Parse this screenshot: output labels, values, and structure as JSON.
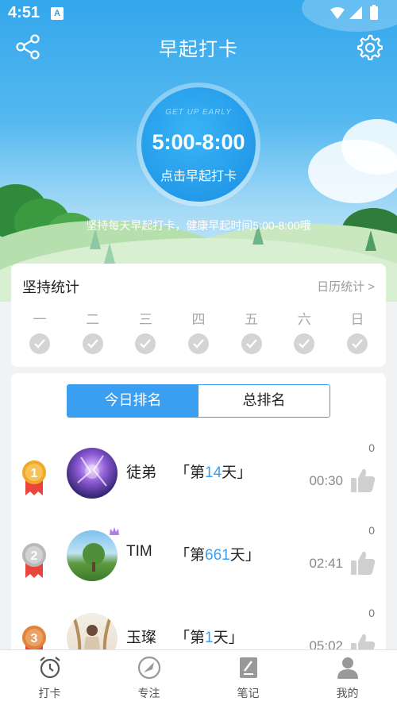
{
  "status_bar": {
    "time": "4:51",
    "notification_glyph": "A"
  },
  "header": {
    "title": "早起打卡",
    "share_icon": "share-icon",
    "settings_icon": "gear-icon"
  },
  "checkin": {
    "tag": "GET UP EARLY",
    "time_range": "5:00-8:00",
    "action_label": "点击早起打卡",
    "tip": "坚持每天早起打卡，健康早起时间5:00-8:00哦"
  },
  "stats": {
    "title": "坚持统计",
    "calendar_link": "日历统计 >",
    "days": [
      "一",
      "二",
      "三",
      "四",
      "五",
      "六",
      "日"
    ]
  },
  "ranking": {
    "tabs": [
      {
        "label": "今日排名",
        "active": true
      },
      {
        "label": "总排名",
        "active": false
      }
    ],
    "rows": [
      {
        "rank": "1",
        "name": "徒弟",
        "streak_prefix": "「第",
        "days": "14",
        "streak_suffix": "天」",
        "time": "00:30",
        "likes": "0",
        "medal_color": "#f0a92a"
      },
      {
        "rank": "2",
        "name": "TIM",
        "streak_prefix": "「第",
        "days": "661",
        "streak_suffix": "天」",
        "time": "02:41",
        "likes": "0",
        "medal_color": "#b9b9b9"
      },
      {
        "rank": "3",
        "name": "玉璨",
        "streak_prefix": "「第",
        "days": "1",
        "streak_suffix": "天」",
        "time": "05:02",
        "likes": "0",
        "medal_color": "#e0843a"
      }
    ]
  },
  "bottom_nav": [
    {
      "label": "打卡",
      "icon": "alarm-clock-icon"
    },
    {
      "label": "专注",
      "icon": "focus-icon"
    },
    {
      "label": "笔记",
      "icon": "notebook-icon"
    },
    {
      "label": "我的",
      "icon": "person-icon"
    }
  ],
  "colors": {
    "accent": "#3a9ff0",
    "sky": "#33a7ec",
    "medal_ribbon": "#e8463c"
  }
}
